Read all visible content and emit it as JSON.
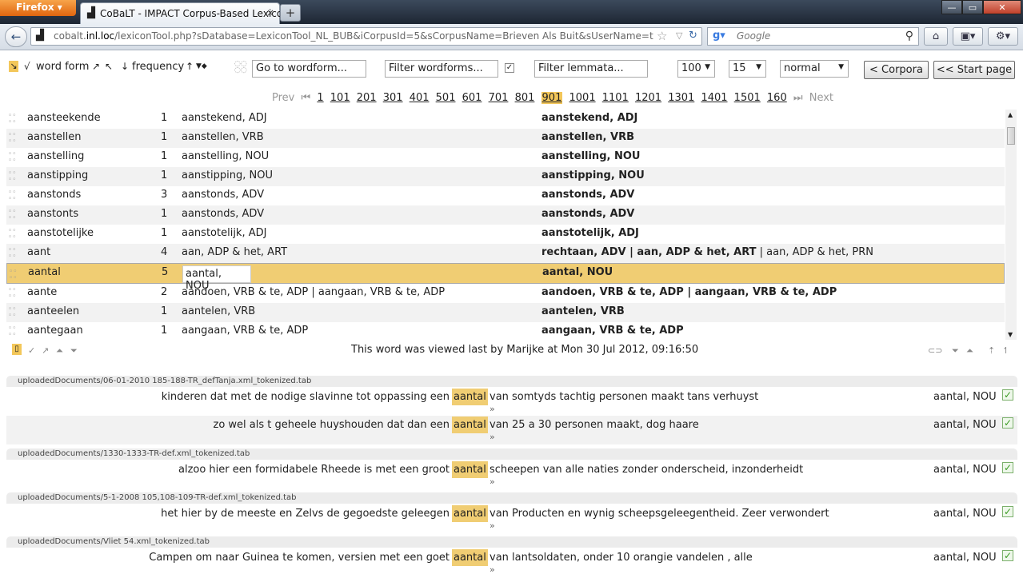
{
  "browser": {
    "menu_button": "Firefox",
    "tab_title": "CoBaLT - IMPACT Corpus-Based Lexico...",
    "tab_close": "×",
    "new_tab": "+",
    "url_prefix": "cobalt.",
    "url_host": "inl.loc",
    "url_rest": "/lexiconTool.php?sDatabase=LexiconTool_NL_BUB&iCorpusId=5&sCorpusName=Brieven Als Buit&sUserName=tom&iUserId=5&",
    "search_engine": "Google"
  },
  "toolbar": {
    "sort_wordform_label": "word form",
    "sort_frequency_label": "frequency",
    "goto_placeholder": "Go to wordform...",
    "filter_wordforms_placeholder": "Filter wordforms...",
    "filter_lemmata_placeholder": "Filter lemmata...",
    "page_size": "100",
    "context_size": "15",
    "view_mode": "normal",
    "corpora_button": "< Corpora",
    "start_page_button": "<< Start page"
  },
  "pager": {
    "prev": "Prev",
    "next": "Next",
    "pages": [
      "1",
      "101",
      "201",
      "301",
      "401",
      "501",
      "601",
      "701",
      "801",
      "901",
      "1001",
      "1101",
      "1201",
      "1301",
      "1401",
      "1501",
      "160"
    ],
    "current": "901"
  },
  "rows": [
    {
      "wordform": "aansteekende",
      "freq": "1",
      "lemma": "aanstekend, ADJ",
      "analysis_bold": "aanstekend, ADJ",
      "analysis_rest": ""
    },
    {
      "wordform": "aanstellen",
      "freq": "1",
      "lemma": "aanstellen, VRB",
      "analysis_bold": "aanstellen, VRB",
      "analysis_rest": ""
    },
    {
      "wordform": "aanstelling",
      "freq": "1",
      "lemma": "aanstelling, NOU",
      "analysis_bold": "aanstelling, NOU",
      "analysis_rest": ""
    },
    {
      "wordform": "aanstipping",
      "freq": "1",
      "lemma": "aanstipping, NOU",
      "analysis_bold": "aanstipping, NOU",
      "analysis_rest": ""
    },
    {
      "wordform": "aanstonds",
      "freq": "3",
      "lemma": "aanstonds, ADV",
      "analysis_bold": "aanstonds, ADV",
      "analysis_rest": ""
    },
    {
      "wordform": "aanstonts",
      "freq": "1",
      "lemma": "aanstonds, ADV",
      "analysis_bold": "aanstonds, ADV",
      "analysis_rest": ""
    },
    {
      "wordform": "aanstotelijke",
      "freq": "1",
      "lemma": "aanstotelijk, ADJ",
      "analysis_bold": "aanstotelijk, ADJ",
      "analysis_rest": ""
    },
    {
      "wordform": "aant",
      "freq": "4",
      "lemma": "aan, ADP & het, ART",
      "analysis_bold": "rechtaan, ADV | aan, ADP & het, ART",
      "analysis_rest": " | aan, ADP & het, PRN"
    },
    {
      "wordform": "aantal",
      "freq": "5",
      "lemma": "aantal, NOU",
      "analysis_bold": "aantal, NOU",
      "analysis_rest": ""
    },
    {
      "wordform": "aante",
      "freq": "2",
      "lemma": "aandoen, VRB & te, ADP | aangaan, VRB & te, ADP",
      "analysis_bold": "aandoen, VRB & te, ADP | aangaan, VRB & te, ADP",
      "analysis_rest": ""
    },
    {
      "wordform": "aanteelen",
      "freq": "1",
      "lemma": "aantelen, VRB",
      "analysis_bold": "aantelen, VRB",
      "analysis_rest": ""
    },
    {
      "wordform": "aantegaan",
      "freq": "1",
      "lemma": "aangaan, VRB & te, ADP",
      "analysis_bold": "aangaan, VRB & te, ADP",
      "analysis_rest": ""
    }
  ],
  "status": {
    "last_viewed": "This word was viewed last by Marijke at Mon 30 Jul 2012, 09:16:50"
  },
  "contexts": [
    {
      "doc": "uploadedDocuments/06-01-2010 185-188-TR_defTanja.xml_tokenized.tab",
      "lines": [
        {
          "left": "kinderen dat met de nodige slavinne tot oppassing een",
          "key": "aantal",
          "right": "van somtyds tachtig personen maakt tans verhuyst",
          "more": "»",
          "analysis": "aantal, NOU",
          "check": "✓"
        },
        {
          "left": "zo wel als t geheele huyshouden dat dan een",
          "key": "aantal",
          "right": "van 25 a 30 personen maakt, dog haare",
          "more": "»",
          "analysis": "aantal, NOU",
          "check": "✓"
        }
      ]
    },
    {
      "doc": "uploadedDocuments/1330-1333-TR-def.xml_tokenized.tab",
      "lines": [
        {
          "left": "alzoo hier een formidabele Rheede is met een groot",
          "key": "aantal",
          "right": "scheepen van alle naties zonder onderscheid, inzonderheidt",
          "more": "»",
          "analysis": "aantal, NOU",
          "check": "✓"
        }
      ]
    },
    {
      "doc": "uploadedDocuments/5-1-2008 105,108-109-TR-def.xml_tokenized.tab",
      "lines": [
        {
          "left": "het hier by de meeste en Zelvs de gegoedste geleegen",
          "key": "aantal",
          "right": "van Producten en wynig scheepsgeleegentheid. Zeer verwondert",
          "more": "»",
          "analysis": "aantal, NOU",
          "check": "✓"
        }
      ]
    },
    {
      "doc": "uploadedDocuments/Vliet 54.xml_tokenized.tab",
      "lines": [
        {
          "left": "Campen om naar Guinea te komen, versien met een goet",
          "key": "aantal",
          "right": "van lantsoldaten, onder 10 orangie vandelen , alle",
          "more": "»",
          "analysis": "aantal, NOU",
          "check": "✓"
        }
      ]
    }
  ]
}
